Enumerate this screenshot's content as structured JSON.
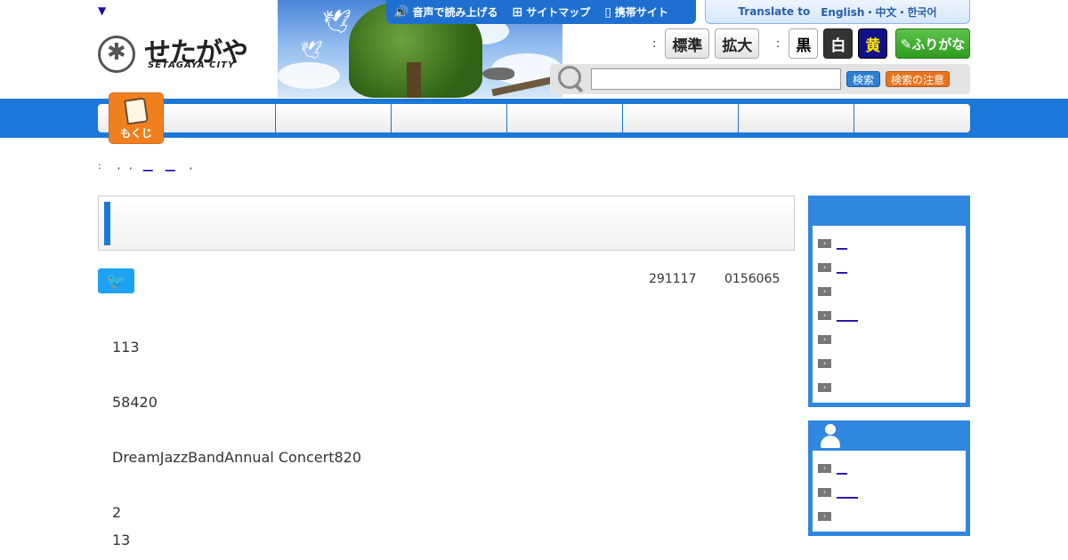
{
  "header": {
    "skip_link": "▼",
    "logo_jp": "せたがや",
    "logo_en": "SETAGAYA CITY",
    "util": [
      {
        "icon": "🔊",
        "label": "音声で読み上げる"
      },
      {
        "icon": "⊞",
        "label": "サイトマップ"
      },
      {
        "icon": "▯",
        "label": "携帯サイト"
      }
    ],
    "translate": {
      "prefix": "Translate to",
      "langs": "English・中文・한국어"
    },
    "size_colon": ":",
    "size_std": "標準",
    "size_big": "拡大",
    "color_colon": ":",
    "color_black": "黒",
    "color_white": "白",
    "color_yellow": "黄",
    "furigana": "✎ふりがな",
    "search_btn": "検索",
    "search_note": "検索の注意"
  },
  "nav": {
    "toc_label": "もくじ"
  },
  "breadcrumb": {
    "colon": ":",
    "sep1": ",",
    "sep2": ",",
    "link1": "__",
    "link2": "__",
    "sep3": ","
  },
  "article": {
    "date": "291117",
    "id": "0156065",
    "lines": [
      "113",
      "58420",
      "DreamJazzBandAnnual Concert820",
      "2",
      "13"
    ]
  },
  "sidebar": {
    "box1_items": [
      "__",
      "__",
      "",
      "____",
      "",
      "",
      ""
    ],
    "box2_items": [
      "__",
      "____",
      ""
    ]
  }
}
